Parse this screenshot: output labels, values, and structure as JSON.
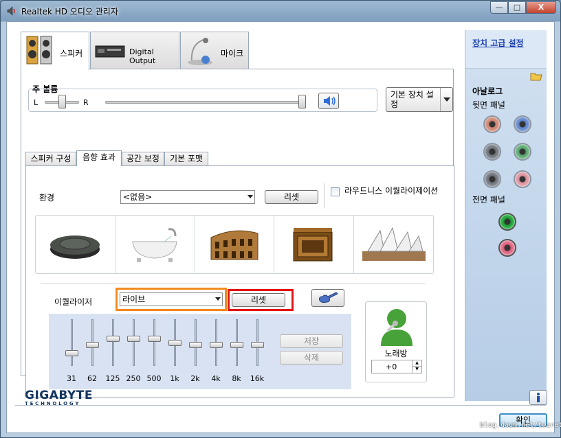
{
  "window": {
    "title": "Realtek HD 오디오 관리자",
    "controls": [
      "—",
      "□",
      "X"
    ]
  },
  "device_tabs": [
    {
      "label": "스피커",
      "icon": "speakers-icon",
      "active": true
    },
    {
      "label": "Digital Output",
      "icon": "digital-output-icon",
      "active": false
    },
    {
      "label": "마이크",
      "icon": "microphone-icon",
      "active": false
    }
  ],
  "main_volume": {
    "title": "주 볼륨",
    "left_label": "L",
    "right_label": "R",
    "balance": 0.5,
    "level": 1.0,
    "mute_icon": "speaker-volume-icon"
  },
  "default_device": {
    "label": "기본 장치 설정"
  },
  "sub_tabs": [
    {
      "label": "스피커 구성",
      "active": false
    },
    {
      "label": "음향 효과",
      "active": true
    },
    {
      "label": "공간 보정",
      "active": false
    },
    {
      "label": "기본 포맷",
      "active": false
    }
  ],
  "environment": {
    "label": "환경",
    "selected": "<없음>",
    "reset_label": "리셋",
    "loudness_label": "라우드니스 이퀄라이제이션",
    "loudness_checked": false,
    "presets": [
      "stone-disc-icon",
      "bathtub-icon",
      "colosseum-icon",
      "wooden-box-icon",
      "opera-house-icon"
    ]
  },
  "equalizer": {
    "label": "이퀄라이저",
    "selected": "라이브",
    "reset_label": "리셋",
    "guitar_icon": "guitar-icon",
    "save_label": "저장",
    "delete_label": "삭제",
    "bands": [
      {
        "freq": "31",
        "level": 0.25
      },
      {
        "freq": "62",
        "level": 0.45
      },
      {
        "freq": "125",
        "level": 0.6
      },
      {
        "freq": "250",
        "level": 0.6
      },
      {
        "freq": "500",
        "level": 0.6
      },
      {
        "freq": "1k",
        "level": 0.5
      },
      {
        "freq": "2k",
        "level": 0.45
      },
      {
        "freq": "4k",
        "level": 0.45
      },
      {
        "freq": "8k",
        "level": 0.45
      },
      {
        "freq": "16k",
        "level": 0.45
      }
    ]
  },
  "karaoke": {
    "label": "노래방",
    "value": "+0",
    "icon": "karaoke-singer-icon"
  },
  "right_panel": {
    "advanced_link": "장치 고급 설정",
    "analog_title": "아날로그",
    "back_panel_label": "뒷면 패널",
    "front_panel_label": "전면 패널",
    "colors": {
      "orange": "#d9826a",
      "blue": "#6a8fd6",
      "gray": "#777d86",
      "green": "#5fae72",
      "pink": "#e49aa6",
      "front_green": "#21a33a",
      "front_pink": "#e26b86"
    }
  },
  "footer": {
    "brand": "GIGABYTE",
    "brand_sub": "TECHNOLOGY",
    "ok_label": "확인",
    "watermark": "blog.daum.net/twaret"
  }
}
